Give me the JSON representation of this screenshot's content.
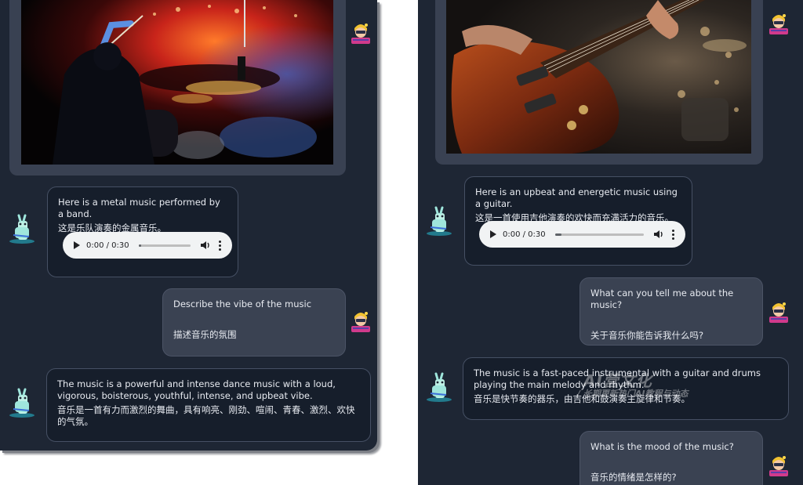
{
  "left_chat": {
    "image_alt": "Drummer performing at a metal concert with red stage lights",
    "bot_message": {
      "en": "Here is a metal music performed by a band.",
      "cn": "这是乐队演奏的金属音乐。",
      "audio": {
        "time": "0:00 / 0:30",
        "progress": 0.05
      }
    },
    "user_message": {
      "en": "Describe the vibe of the music",
      "cn": "描述音乐的氛围"
    },
    "bot_reply": {
      "en": "The music is a powerful and intense dance music with a loud, vigorous, boisterous, youthful, intense, and upbeat vibe.",
      "cn": "音乐是一首有力而激烈的舞曲，具有响亮、刚劲、喧闹、青春、激烈、欢快的气氛。"
    }
  },
  "right_chat": {
    "image_alt": "Close-up of a guitarist playing an electric guitar on stage",
    "bot_message": {
      "en": "Here is an upbeat and energetic music using a guitar.",
      "cn": "这是一首使用吉他演奏的欢快而充满活力的音乐。",
      "audio": {
        "time": "0:00 / 0:30",
        "progress": 0.07
      }
    },
    "user_message_1": {
      "en": "What can you tell me about the music?",
      "cn": "关于音乐你能告诉我什么吗?"
    },
    "bot_reply": {
      "en": "The music is a fast-paced instrumental with a guitar and drums playing the main melody and rhythm.",
      "cn": "音乐是快节奏的器乐，由吉他和鼓演奏主旋律和节奏。"
    },
    "user_message_2": {
      "en": "What is the mood of the music?",
      "cn": "音乐的情绪是怎样的?"
    }
  },
  "watermark": {
    "main": "AI营文化",
    "sub": "/ 长期更新热门AI教程与动态"
  },
  "icons": {
    "user_avatar": "girl-avatar-icon",
    "bot_avatar": "llama-avatar-icon",
    "play": "play-icon",
    "volume": "volume-icon",
    "more": "kebab-menu-icon"
  }
}
